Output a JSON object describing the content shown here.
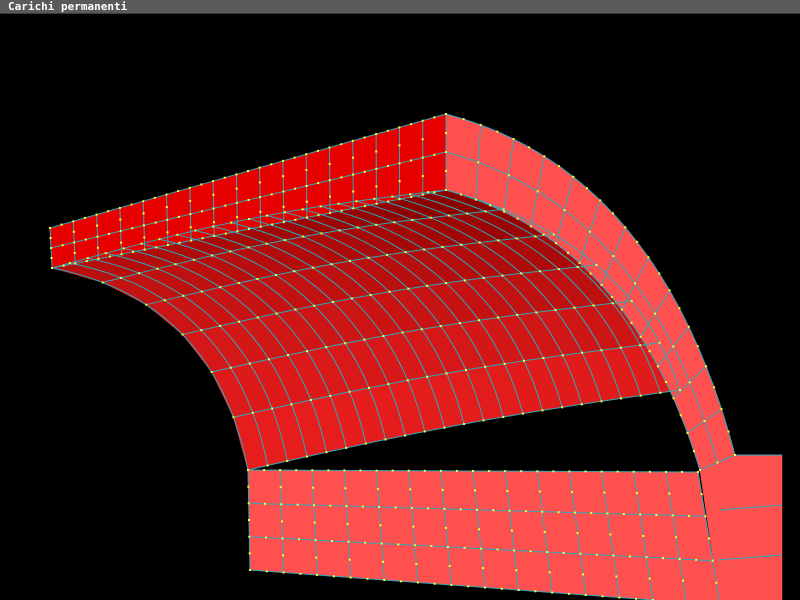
{
  "window": {
    "title": "Carichi permanenti",
    "background": "#000000",
    "titlebar_color": "#5a5a5a"
  },
  "model": {
    "description_visible": false,
    "colors": {
      "face_light": "#ff5050",
      "face_mid": "#f02020",
      "face_dark": "#8c0000",
      "top_face": "#e60000",
      "mesh_lines": "#2fa8b8",
      "nodes": "#ffff33"
    }
  }
}
